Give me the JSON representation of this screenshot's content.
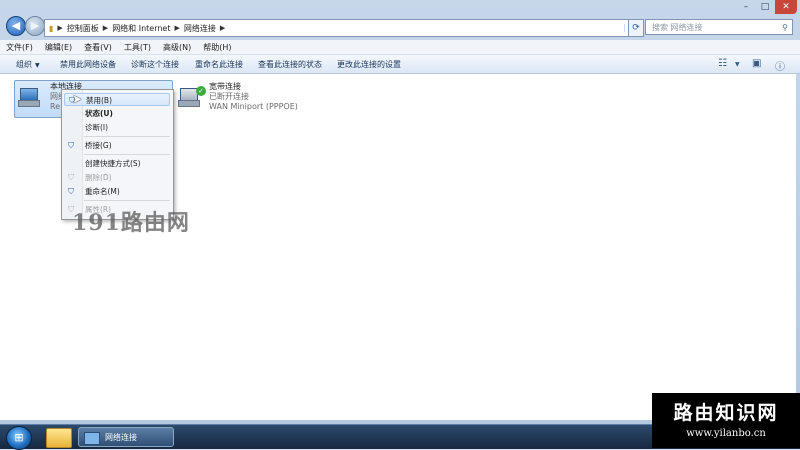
{
  "breadcrumb": [
    "控制面板",
    "网络和 Internet",
    "网络连接"
  ],
  "search_placeholder": "搜索 网络连接",
  "menus": [
    "文件(F)",
    "编辑(E)",
    "查看(V)",
    "工具(T)",
    "高级(N)",
    "帮助(H)"
  ],
  "commands": [
    "组织",
    "禁用此网络设备",
    "诊断这个连接",
    "重命名此连接",
    "查看此连接的状态",
    "更改此连接的设置"
  ],
  "connections": [
    {
      "name": "本地连接",
      "status": "网络",
      "device": "Re",
      "icon": "network-adapter-icon",
      "selected": true
    },
    {
      "name": "宽带连接",
      "status": "已断开连接",
      "device": "WAN Miniport (PPPOE)",
      "icon": "dialup-adapter-icon",
      "selected": false
    }
  ],
  "context_menu": [
    {
      "label": "禁用(B)",
      "shield": true,
      "highlighted": true,
      "disabled": false,
      "bold": false
    },
    {
      "label": "状态(U)",
      "shield": false,
      "highlighted": false,
      "disabled": false,
      "bold": true
    },
    {
      "label": "诊断(I)",
      "shield": false,
      "highlighted": false,
      "disabled": false,
      "bold": false
    },
    {
      "label": "桥接(G)",
      "shield": true,
      "highlighted": false,
      "disabled": false,
      "bold": false
    },
    {
      "label": "创建快捷方式(S)",
      "shield": false,
      "highlighted": false,
      "disabled": false,
      "bold": false
    },
    {
      "label": "删除(D)",
      "shield": true,
      "highlighted": false,
      "disabled": true,
      "bold": false
    },
    {
      "label": "重命名(M)",
      "shield": true,
      "highlighted": false,
      "disabled": false,
      "bold": false
    },
    {
      "label": "属性(R)",
      "shield": true,
      "highlighted": false,
      "disabled": true,
      "bold": false
    }
  ],
  "watermark_left": "191路由网",
  "watermark_right": {
    "title": "路由知识网",
    "url": "www.yilanbo.cn"
  },
  "taskbar": {
    "active_task": "网络连接"
  }
}
